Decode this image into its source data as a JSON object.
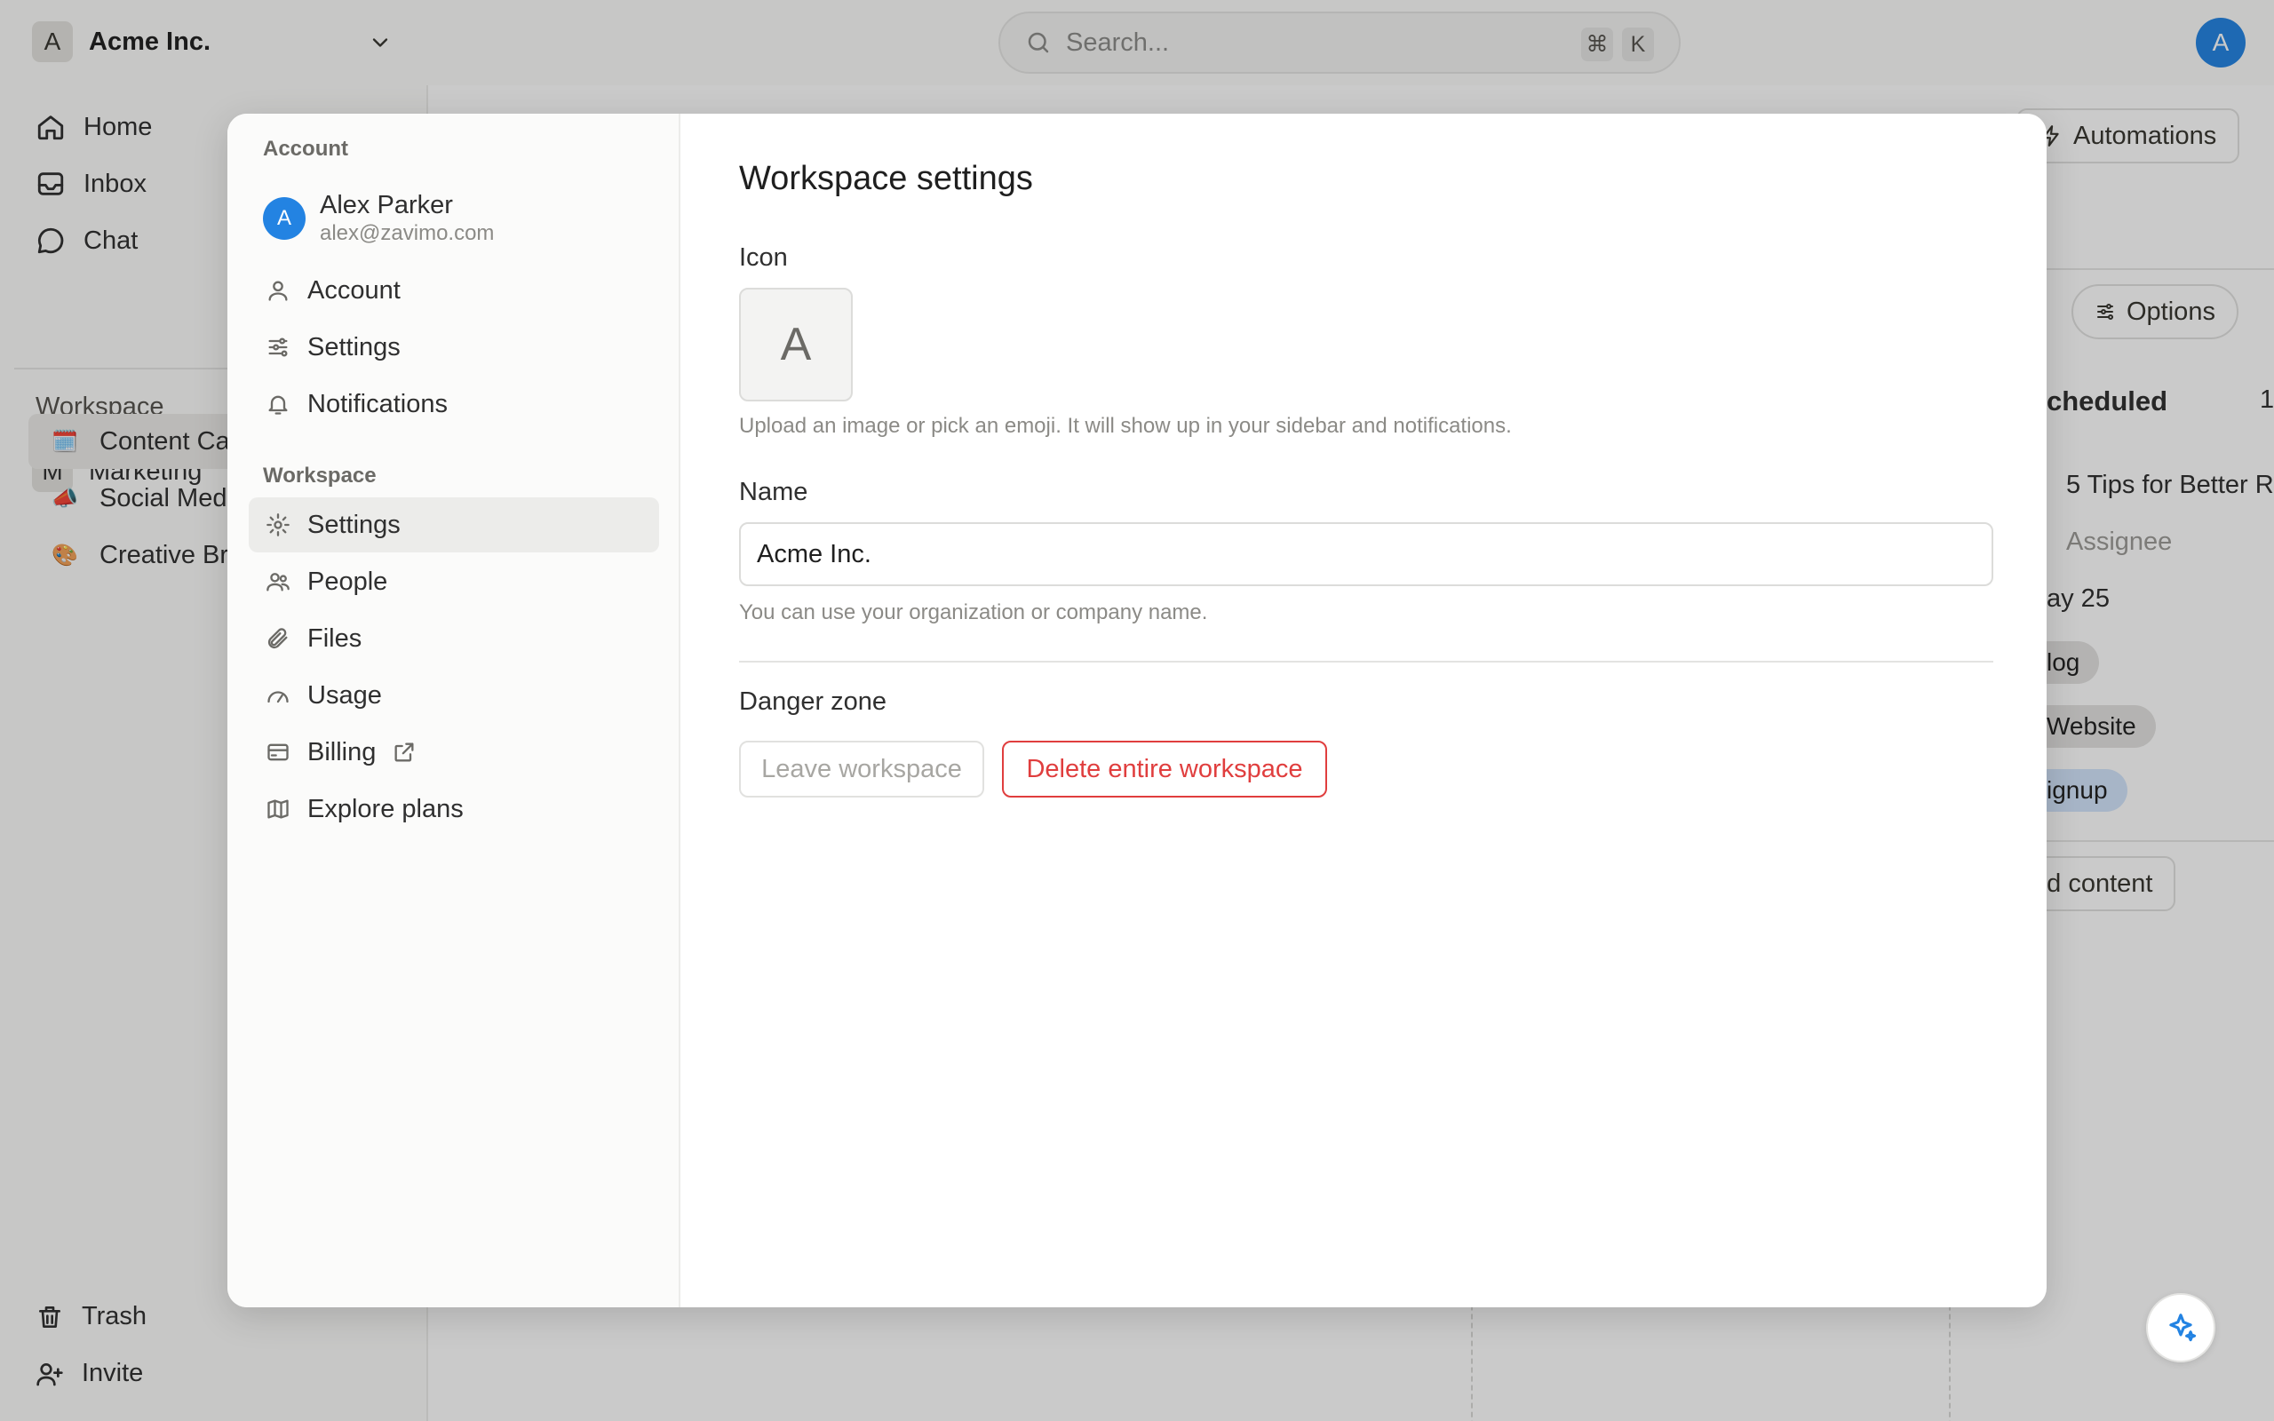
{
  "colors": {
    "accent": "#2383e2",
    "danger": "#e03e3e"
  },
  "topbar": {
    "workspace_logo_letter": "A",
    "workspace_name": "Acme Inc.",
    "search_placeholder": "Search...",
    "shortcut_cmd": "⌘",
    "shortcut_key": "K",
    "user_avatar_letter": "A"
  },
  "sidebar": {
    "nav": [
      {
        "label": "Home",
        "icon": "home-icon"
      },
      {
        "label": "Inbox",
        "icon": "inbox-icon"
      },
      {
        "label": "Chat",
        "icon": "chat-icon"
      }
    ],
    "workspace_label": "Workspace",
    "team": {
      "letter": "M",
      "name": "Marketing"
    },
    "pages": [
      {
        "emoji": "🗓️",
        "label": "Content Ca"
      },
      {
        "emoji": "📣",
        "label": "Social Med"
      },
      {
        "emoji": "🎨",
        "label": "Creative Br"
      }
    ],
    "footer": [
      {
        "label": "Trash",
        "icon": "trash-icon"
      },
      {
        "label": "Invite",
        "icon": "invite-icon"
      }
    ]
  },
  "background": {
    "automations_label": "Automations",
    "options_label": "Options",
    "column_title": "cheduled",
    "column_count": "1",
    "card_title": "5 Tips for Better R",
    "assignee_label": "Assignee",
    "date_text": "ay 25",
    "tags": [
      "log",
      "Website",
      "ignup"
    ],
    "add_content_label": "dd content"
  },
  "modal": {
    "sidebar": {
      "account_section": "Account",
      "user": {
        "avatar_letter": "A",
        "name": "Alex Parker",
        "email": "alex@zavimo.com"
      },
      "account_items": [
        {
          "label": "Account",
          "icon": "user-icon"
        },
        {
          "label": "Settings",
          "icon": "sliders-icon"
        },
        {
          "label": "Notifications",
          "icon": "bell-icon"
        }
      ],
      "workspace_section": "Workspace",
      "workspace_items": [
        {
          "label": "Settings",
          "icon": "gear-icon",
          "active": true
        },
        {
          "label": "People",
          "icon": "people-icon"
        },
        {
          "label": "Files",
          "icon": "paperclip-icon"
        },
        {
          "label": "Usage",
          "icon": "gauge-icon"
        },
        {
          "label": "Billing",
          "icon": "credit-card-icon",
          "external": true
        },
        {
          "label": "Explore plans",
          "icon": "map-icon"
        }
      ]
    },
    "content": {
      "title": "Workspace settings",
      "icon_label": "Icon",
      "icon_letter": "A",
      "icon_hint": "Upload an image or pick an emoji. It will show up in your sidebar and notifications.",
      "name_label": "Name",
      "name_value": "Acme Inc.",
      "name_hint": "You can use your organization or company name.",
      "danger_label": "Danger zone",
      "leave_label": "Leave workspace",
      "delete_label": "Delete entire workspace"
    }
  }
}
